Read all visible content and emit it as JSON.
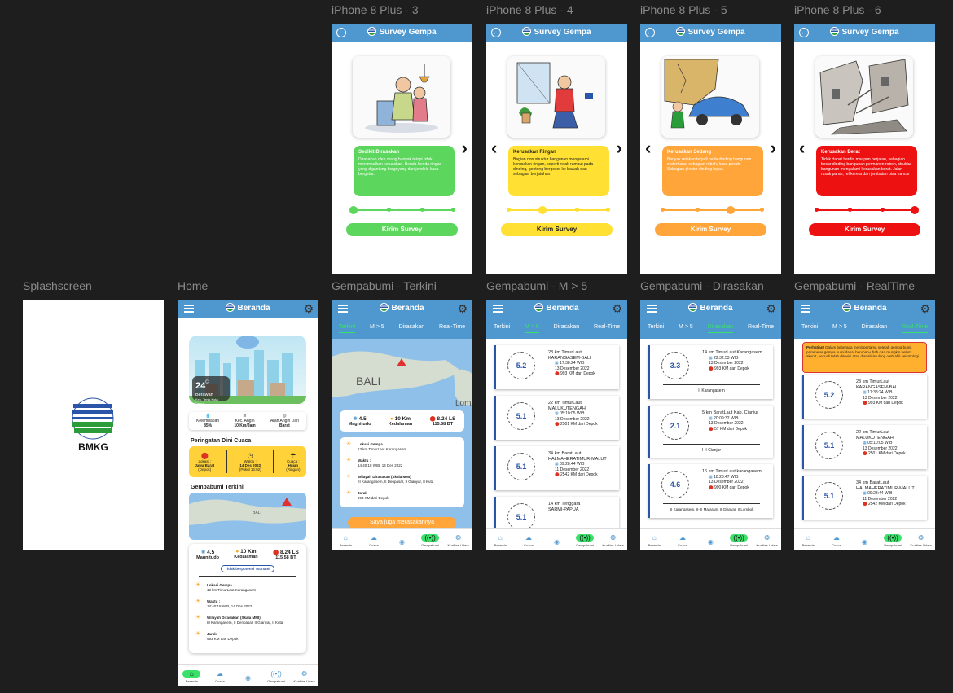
{
  "labels": {
    "splash": "Splashscreen",
    "home": "Home",
    "survey3": "iPhone 8 Plus - 3",
    "survey4": "iPhone 8 Plus - 4",
    "survey5": "iPhone 8 Plus - 5",
    "survey6": "iPhone 8 Plus - 6",
    "terkini": "Gempabumi - Terkini",
    "m5": "Gempabumi - M > 5",
    "dirasakan": "Gempabumi - Dirasakan",
    "realtime": "Gempabumi - RealTime"
  },
  "colors": {
    "header": "#4f97cf",
    "green": "#5cd65c",
    "yellow": "#ffe033",
    "orange": "#ffa53a",
    "red": "#ee1111",
    "active": "#39e06a"
  },
  "splash": {
    "brand": "BMKG"
  },
  "survey": {
    "title": "Survey Gempa",
    "send": "Kirim Survey",
    "levels": [
      {
        "title": "Sedikit Dirasakan",
        "text": "Dirasakan oleh orang banyak tetapi tidak menimbulkan kerusakan. Benda-benda ringan yang digantung bergoyang dan jendela kaca bergetar."
      },
      {
        "title": "Kerusakan Ringan",
        "text": "Bagian non struktur bangunan mengalami kerusakan ringan, seperti retak rambut pada dinding, genteng bergeser ke bawah dan sebagian berjatuhan."
      },
      {
        "title": "Kerusakan Sedang",
        "text": "Banyak retakan terjadi pada dinding bangunan sederhana, sebagian roboh, kaca pecah. Sebagian plester dinding lepas."
      },
      {
        "title": "Kerusakan Berat",
        "text": "Tidak dapat berdiri maupun berjalan, sebagian besar dinding bangunan permanen roboh, struktur bangunan mengalami kerusakan berat. Jalan rusak parah, rel kereta dan jembatan bisa hancur"
      }
    ]
  },
  "header": {
    "title": "Beranda"
  },
  "tabs": [
    "Terkini",
    "M > 5",
    "Dirasakan",
    "Real-Time"
  ],
  "nav": [
    "Beranda",
    "Cuaca",
    "",
    "Gempabumi",
    "Kualitas Udara"
  ],
  "home": {
    "temp": "24",
    "unit": "C",
    "weather": "Berawan",
    "place": "Kec. Tenis Kota Depok",
    "stats": [
      {
        "label": "Kelembaban",
        "value": "85%"
      },
      {
        "label": "Kec. Angin",
        "value": "10 Km/Jam"
      },
      {
        "label": "Arah Angin Dari",
        "value": "Barat"
      }
    ],
    "warning_title": "Peringatan Dini Cuaca",
    "warning": [
      {
        "label": "Lokasi :",
        "value": "Jawa Barat",
        "sub": "(Depok)"
      },
      {
        "label": "Waktu :",
        "value": "14 Des 2022",
        "sub": "(Pukul 16:02)"
      },
      {
        "label": "Cuaca :",
        "value": "Hujan",
        "sub": "(Ringan)"
      }
    ],
    "quake_title": "Gempabumi Terkini",
    "map_label": "BALI",
    "tsunami": "Tidak berpotensi Tsunami"
  },
  "quake": {
    "mag": "4.5",
    "mag_label": "Magnitudo",
    "depth": "10 Km",
    "depth_label": "Kedalaman",
    "coord": "8.24 LS",
    "coord_sub": "115.58 BT",
    "details": [
      {
        "title": "Lokasi Gempa",
        "value": "13 km TimurLaut Karangasem"
      },
      {
        "title": "Waktu :",
        "value": "14:40:18 WIB, 14 Des 2022"
      },
      {
        "title": "Wilayah Dirasakan (Skala MMI)",
        "value": "III Karangasem, II Denpasar, II Gianyar, II Kuta"
      },
      {
        "title": "Jarak",
        "value": "993 KM dari Depok"
      }
    ],
    "feel_button": "Saya juga merasakannya",
    "map_labels": [
      "BALI",
      "Lom"
    ]
  },
  "m5_list": [
    {
      "mag": "5.2",
      "place": "23 km TimurLaut",
      "region": "KARANGASEM-BALI",
      "time": "17:38:24 WIB",
      "date": "13 Desember 2022",
      "dist": "993 KM dari Depok"
    },
    {
      "mag": "5.1",
      "place": "22 km TimurLaut",
      "region": "MALUKUTENGAH",
      "time": "05:10:05 WIB",
      "date": "13 Desember 2022",
      "dist": "2501 KM dari Depok"
    },
    {
      "mag": "5.1",
      "place": "34 km BaratLaut",
      "region": "HALMAHERATIMUR-MALUT",
      "time": "09:28:44 WIB",
      "date": "11 Desember 2022",
      "dist": "2542 KM dari Depok"
    },
    {
      "mag": "5.1",
      "place": "14 km Tenggara",
      "region": "SARMI-PAPUA",
      "time": "",
      "date": "",
      "dist": ""
    }
  ],
  "felt_list": [
    {
      "mag": "3.3",
      "place": "14 km TimurLaut Karangasem",
      "time": "22:32:53 WIB",
      "date": "13 Desember 2022",
      "dist": "993 KM dari Depok",
      "mmi": "II Karangasem"
    },
    {
      "mag": "2.1",
      "place": "5 km BaratLaut Kab. Cianjur",
      "time": "20:09:32 WIB",
      "date": "13 Desember 2022",
      "dist": "57 KM dari Depok",
      "mmi": "I-II Cianjur"
    },
    {
      "mag": "4.6",
      "place": "16 km TimurLaut karangasem",
      "time": "18:23:47 WIB",
      "date": "13 Desember 2022",
      "dist": "990 KM dari Depok",
      "mmi": "III Karangasem, II-III Mataram, II Gianyar, II Lombok"
    }
  ],
  "realtime": {
    "notice_bold": "Perhatian!",
    "notice": "Dalam beberapa menit pertama setelah gempa bumi, parameter gempa bumi dapat berubah-ubah dan mungkin belum akurat, kecuali telah direvisi atau dianalisis ulang oleh ahli seismologi"
  }
}
